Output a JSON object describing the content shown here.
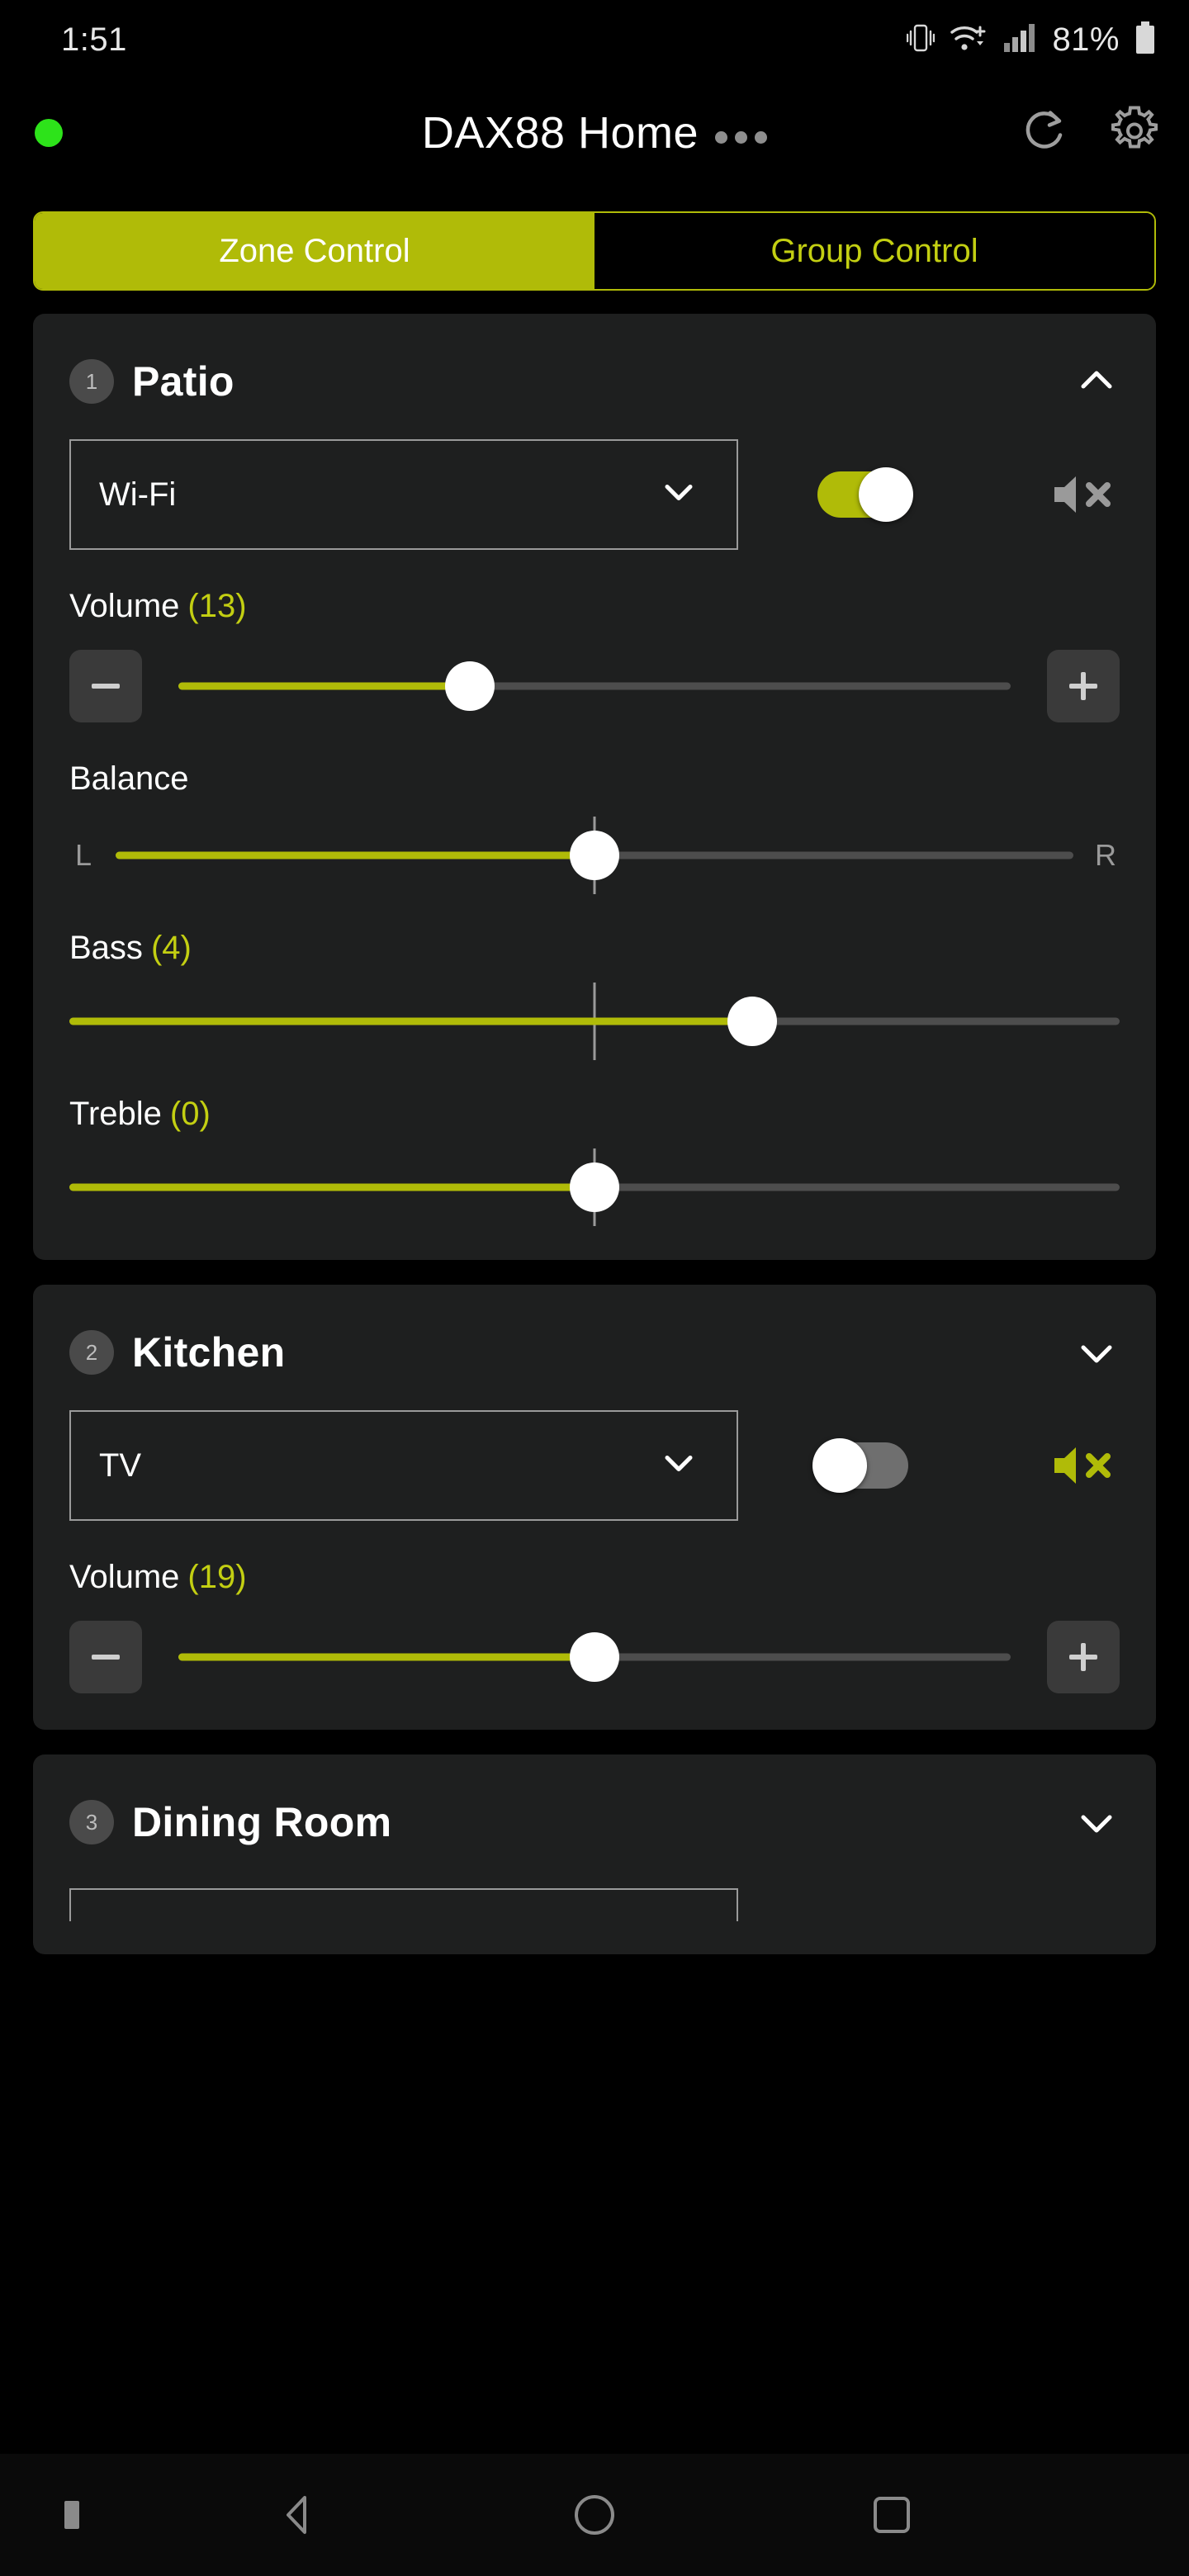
{
  "statusbar": {
    "time": "1:51",
    "battery_percent": "81%",
    "icons": [
      "vibrate-icon",
      "wifi-plus-icon",
      "cellular-signal-icon",
      "battery-icon"
    ]
  },
  "header": {
    "title": "DAX88 Home",
    "overflow_dots": "•••",
    "connection_dot_color": "#2de31a",
    "refresh_icon": "refresh-icon",
    "settings_icon": "gear-icon"
  },
  "tabs": [
    {
      "label": "Zone Control",
      "active": true
    },
    {
      "label": "Group Control",
      "active": false
    }
  ],
  "theme": {
    "accent": "#b0bb08",
    "accent_text": "#c3cf12",
    "card_bg": "#1e1f1f",
    "page_bg": "#000000",
    "track_bg": "#4d4d4d",
    "muted_icon": "#9a9a9a"
  },
  "zones": [
    {
      "number": "1",
      "name": "Patio",
      "expanded": true,
      "chevron": "chevron-up-icon",
      "source": {
        "value": "Wi-Fi",
        "chevron": "chevron-down-icon"
      },
      "power": {
        "state": "on"
      },
      "mute": {
        "state": "off",
        "icon": "speaker-mute-icon"
      },
      "volume": {
        "label": "Volume",
        "value": "13",
        "percent": 35,
        "minus": "−",
        "plus": "+"
      },
      "balance": {
        "label": "Balance",
        "left": "L",
        "right": "R",
        "percent": 50
      },
      "bass": {
        "label": "Bass",
        "value": "4",
        "percent": 65
      },
      "treble": {
        "label": "Treble",
        "value": "0",
        "percent": 50
      }
    },
    {
      "number": "2",
      "name": "Kitchen",
      "expanded": true,
      "chevron": "chevron-down-icon",
      "source": {
        "value": "TV",
        "chevron": "chevron-down-icon"
      },
      "power": {
        "state": "off"
      },
      "mute": {
        "state": "on",
        "icon": "speaker-mute-icon"
      },
      "volume": {
        "label": "Volume",
        "value": "19",
        "percent": 50,
        "minus": "−",
        "plus": "+"
      }
    },
    {
      "number": "3",
      "name": "Dining Room",
      "expanded": true,
      "chevron": "chevron-down-icon"
    }
  ],
  "navbar": {
    "items": [
      "back-icon",
      "home-icon",
      "recents-icon"
    ]
  }
}
